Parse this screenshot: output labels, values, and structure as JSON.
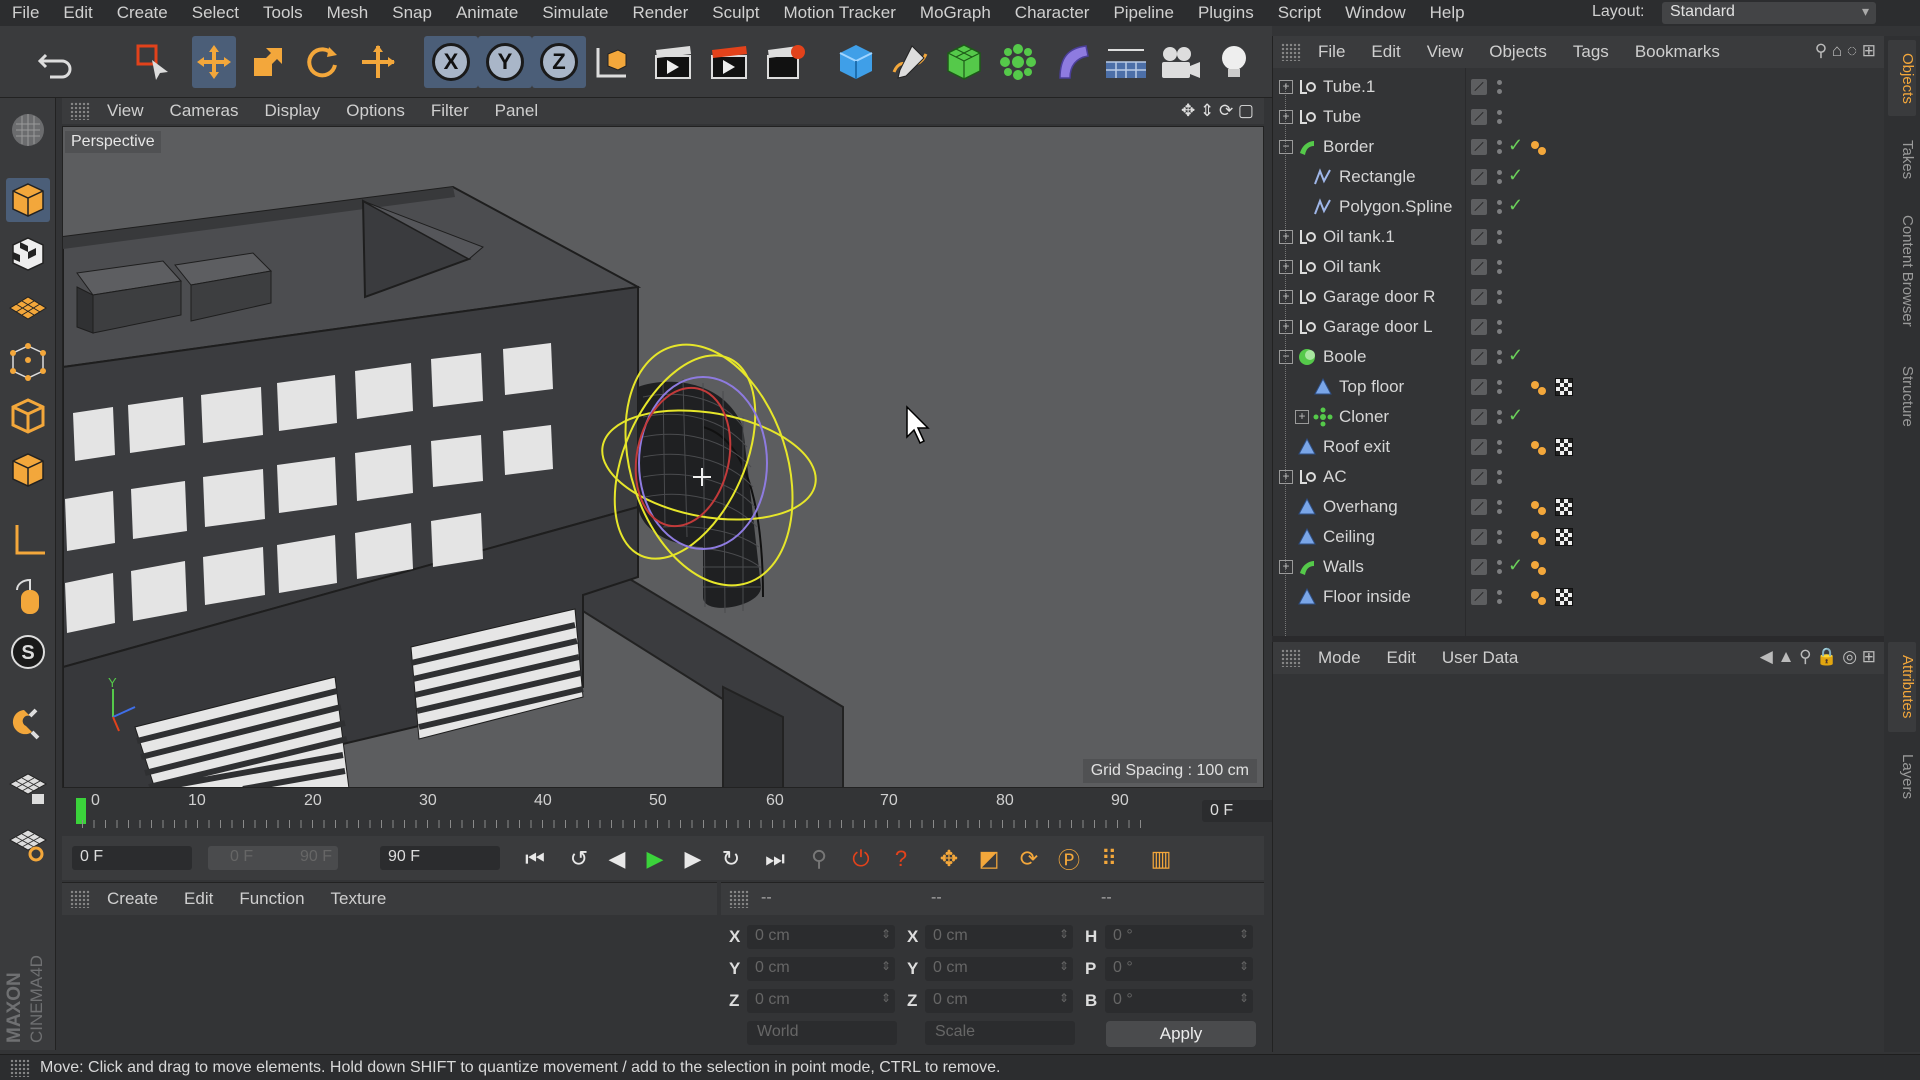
{
  "menubar": {
    "items": [
      "File",
      "Edit",
      "Create",
      "Select",
      "Tools",
      "Mesh",
      "Snap",
      "Animate",
      "Simulate",
      "Render",
      "Sculpt",
      "Motion Tracker",
      "MoGraph",
      "Character",
      "Pipeline",
      "Plugins",
      "Script",
      "Window",
      "Help"
    ],
    "layout_label": "Layout:",
    "layout_value": "Standard"
  },
  "toolbar": {
    "axis_x": "X",
    "axis_y": "Y",
    "axis_z": "Z"
  },
  "viewport": {
    "menu": [
      "View",
      "Cameras",
      "Display",
      "Options",
      "Filter",
      "Panel"
    ],
    "label": "Perspective",
    "grid_spacing": "Grid Spacing : 100 cm",
    "axis_y_label": "Y"
  },
  "timeline": {
    "ticks": [
      "0",
      "10",
      "20",
      "30",
      "40",
      "50",
      "60",
      "70",
      "80",
      "90"
    ],
    "current_frame": "0 F",
    "start_field": "0 F",
    "range_min": "0 F",
    "range_max": "90 F",
    "end_field": "90 F"
  },
  "materials": {
    "menu": [
      "Create",
      "Edit",
      "Function",
      "Texture"
    ]
  },
  "coordinates": {
    "header_dashes": [
      "--",
      "--",
      "--"
    ],
    "pos_labels": [
      "X",
      "Y",
      "Z"
    ],
    "pos_values": [
      "0 cm",
      "0 cm",
      "0 cm"
    ],
    "size_labels": [
      "X",
      "Y",
      "Z"
    ],
    "size_values": [
      "0 cm",
      "0 cm",
      "0 cm"
    ],
    "rot_labels": [
      "H",
      "P",
      "B"
    ],
    "rot_values": [
      "0 °",
      "0 °",
      "0 °"
    ],
    "mode_world": "World",
    "mode_scale": "Scale",
    "apply_label": "Apply"
  },
  "object_manager": {
    "menu": [
      "File",
      "Edit",
      "View",
      "Objects",
      "Tags",
      "Bookmarks"
    ],
    "rows": [
      {
        "name": "Tube.1",
        "icon": "null-icon",
        "indent": 0,
        "expander": "+",
        "check": false,
        "phong": false,
        "material": false
      },
      {
        "name": "Tube",
        "icon": "null-icon",
        "indent": 0,
        "expander": "+",
        "check": false,
        "phong": false,
        "material": false
      },
      {
        "name": "Border",
        "icon": "sweep-icon",
        "indent": 0,
        "expander": "−",
        "check": true,
        "phong": true,
        "material": false
      },
      {
        "name": "Rectangle",
        "icon": "spline-icon",
        "indent": 1,
        "expander": "",
        "check": true,
        "phong": false,
        "material": false
      },
      {
        "name": "Polygon.Spline",
        "icon": "spline-icon",
        "indent": 1,
        "expander": "",
        "check": true,
        "phong": false,
        "material": false
      },
      {
        "name": "Oil tank.1",
        "icon": "null-icon",
        "indent": 0,
        "expander": "+",
        "check": false,
        "phong": false,
        "material": false
      },
      {
        "name": "Oil tank",
        "icon": "null-icon",
        "indent": 0,
        "expander": "+",
        "check": false,
        "phong": false,
        "material": false
      },
      {
        "name": "Garage door R",
        "icon": "null-icon",
        "indent": 0,
        "expander": "+",
        "check": false,
        "phong": false,
        "material": false
      },
      {
        "name": "Garage door L",
        "icon": "null-icon",
        "indent": 0,
        "expander": "+",
        "check": false,
        "phong": false,
        "material": false
      },
      {
        "name": "Boole",
        "icon": "boole-icon",
        "indent": 0,
        "expander": "−",
        "check": true,
        "phong": false,
        "material": false
      },
      {
        "name": "Top floor",
        "icon": "polygon-icon",
        "indent": 1,
        "expander": "",
        "check": false,
        "phong": true,
        "material": true
      },
      {
        "name": "Cloner",
        "icon": "cloner-icon",
        "indent": 1,
        "expander": "+",
        "check": true,
        "phong": false,
        "material": false
      },
      {
        "name": "Roof exit",
        "icon": "polygon-icon",
        "indent": 0,
        "expander": "",
        "check": false,
        "phong": true,
        "material": true
      },
      {
        "name": "AC",
        "icon": "null-icon",
        "indent": 0,
        "expander": "+",
        "check": false,
        "phong": false,
        "material": false
      },
      {
        "name": "Overhang",
        "icon": "polygon-icon",
        "indent": 0,
        "expander": "",
        "check": false,
        "phong": true,
        "material": true
      },
      {
        "name": "Ceiling",
        "icon": "polygon-icon",
        "indent": 0,
        "expander": "",
        "check": false,
        "phong": true,
        "material": true
      },
      {
        "name": "Walls",
        "icon": "sweep-icon",
        "indent": 0,
        "expander": "+",
        "check": true,
        "phong": true,
        "material": false
      },
      {
        "name": "Floor inside",
        "icon": "polygon-icon",
        "indent": 0,
        "expander": "",
        "check": false,
        "phong": true,
        "material": true
      }
    ]
  },
  "attributes": {
    "menu": [
      "Mode",
      "Edit",
      "User Data"
    ]
  },
  "side_tabs": [
    "Objects",
    "Takes",
    "Content Browser",
    "Structure"
  ],
  "side_tabs_lower": [
    "Attributes",
    "Layers"
  ],
  "status": "Move: Click and drag to move elements. Hold down SHIFT to quantize movement / add to the selection in point mode, CTRL to remove.",
  "colors": {
    "accent": "#f3a73b",
    "selection_blue": "#4b5e78",
    "check_green": "#6bd05a",
    "deformer_yellow": "#e6e62a"
  }
}
